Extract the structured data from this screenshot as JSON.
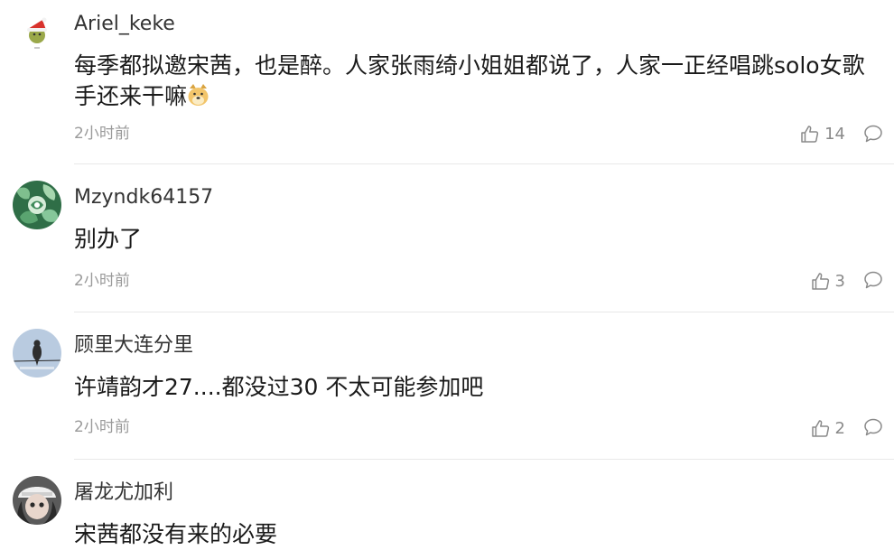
{
  "comments": [
    {
      "username": "Ariel_keke",
      "text": "每季都拟邀宋茜，也是醉。人家张雨绮小姐姐都说了，人家一正经唱跳solo女歌手还来干嘛",
      "emoji": "doge-emoji",
      "time": "2小时前",
      "likes": "14",
      "avatar": "santa-hat-avatar"
    },
    {
      "username": "Mzyndk64157",
      "text": "别办了",
      "time": "2小时前",
      "likes": "3",
      "avatar": "green-leaf-avatar"
    },
    {
      "username": "顾里大连分里",
      "text": "许靖韵才27....都没过30 不太可能参加吧",
      "time": "2小时前",
      "likes": "2",
      "avatar": "bird-on-wire-avatar"
    },
    {
      "username": "屠龙尤加利",
      "text": "宋茜都没有来的必要",
      "avatar": "person-with-cap-avatar"
    }
  ]
}
